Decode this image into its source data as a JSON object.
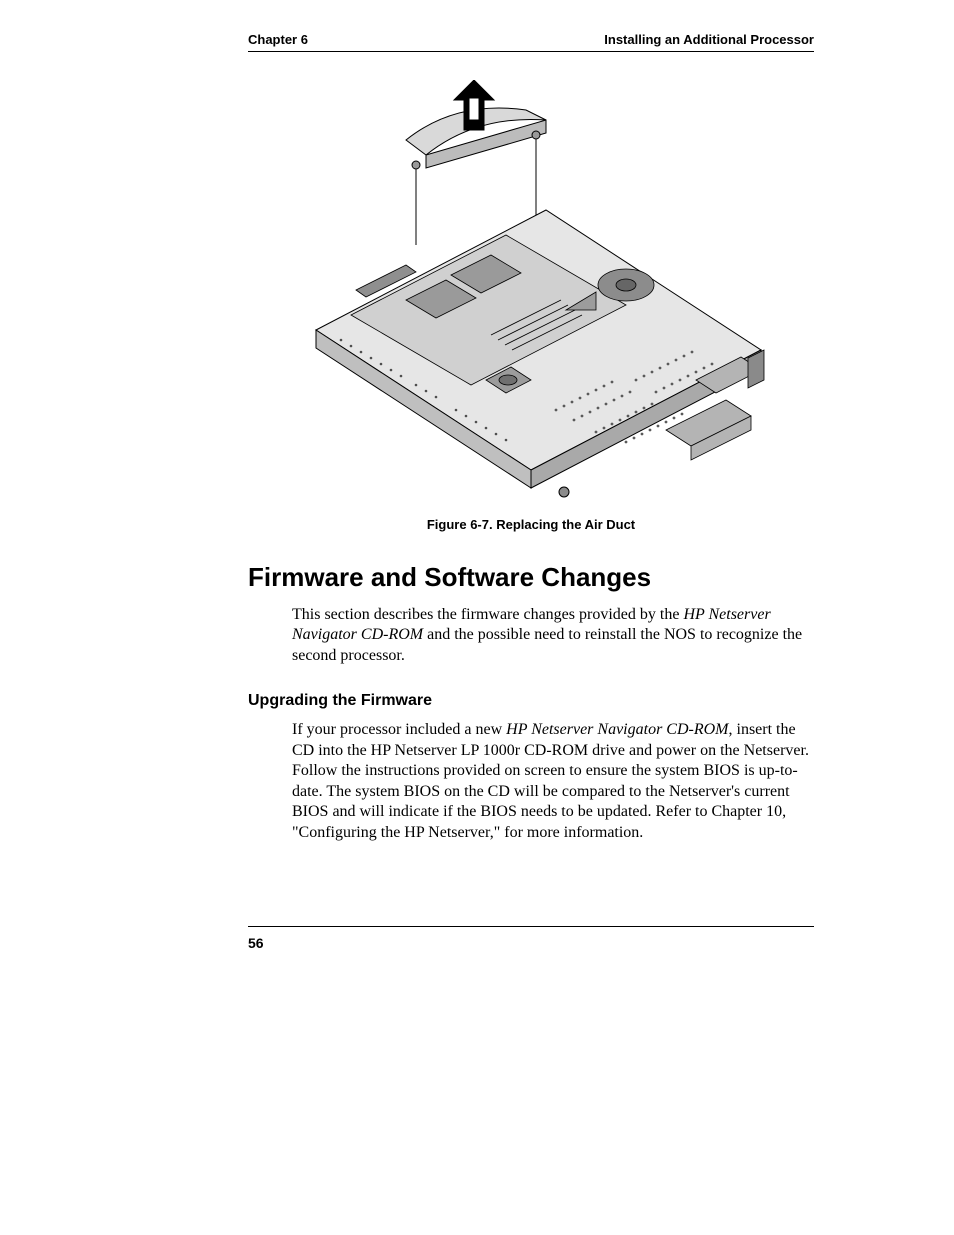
{
  "header": {
    "left": "Chapter 6",
    "right": "Installing an Additional Processor"
  },
  "figure": {
    "caption": "Figure 6-7. Replacing the Air Duct"
  },
  "section": {
    "title": "Firmware and Software Changes",
    "intro_pre": "This section describes the firmware changes provided by the ",
    "intro_em": "HP Netserver Navigator CD-ROM",
    "intro_post": " and the possible need to reinstall the NOS to recognize the second processor."
  },
  "subsection": {
    "title": "Upgrading the Firmware",
    "p_pre": "If your processor included a new ",
    "p_em": "HP Netserver Navigator CD-ROM",
    "p_post": ", insert the CD into the HP Netserver LP 1000r CD-ROM drive and power on the Netserver. Follow the instructions provided on screen to ensure the system BIOS is up-to-date. The system BIOS on the CD will be compared to the Netserver's current BIOS and will indicate if the BIOS needs to be updated. Refer to Chapter 10, \"Configuring the HP Netserver,\" for more information."
  },
  "page_number": "56"
}
